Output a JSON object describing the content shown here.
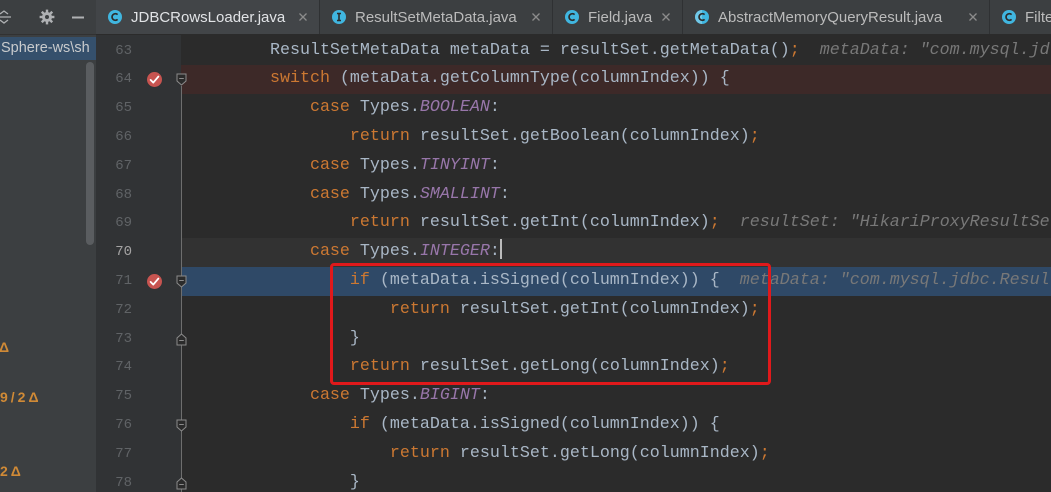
{
  "project_panel": {
    "toolbar_icons": [
      "collapse-all-icon",
      "gear-icon",
      "hide-icon"
    ],
    "selected_item": "Sphere-ws\\sh",
    "change_markers": [
      "Δ",
      "9/2Δ",
      "2Δ"
    ]
  },
  "tabs": [
    {
      "label": "JDBCRowsLoader.java",
      "icon": "class-icon",
      "active": true
    },
    {
      "label": "ResultSetMetaData.java",
      "icon": "interface-icon",
      "active": false
    },
    {
      "label": "Field.java",
      "icon": "class-icon",
      "active": false
    },
    {
      "label": "AbstractMemoryQueryResult.java",
      "icon": "abstract-class-icon",
      "active": false
    },
    {
      "label": "Filte",
      "icon": "class-icon",
      "active": false
    }
  ],
  "editor": {
    "lines": [
      {
        "number": 63,
        "segments": [
          {
            "plain": "        ResultSetMetaData metaData = resultSet.getMetaData()"
          },
          {
            "punct": ";"
          }
        ],
        "hint": "metaData: \"com.mysql.jd"
      },
      {
        "number": 64,
        "breakpoint": true,
        "fold_start": true,
        "segments": [
          {
            "keyword": "        switch"
          },
          {
            "plain": " (metaData.getColumnType(columnIndex)) {"
          }
        ]
      },
      {
        "number": 65,
        "segments": [
          {
            "keyword": "            case"
          },
          {
            "plain": " Types."
          },
          {
            "constant": "BOOLEAN"
          },
          {
            "plain": ":"
          }
        ]
      },
      {
        "number": 66,
        "segments": [
          {
            "keyword": "                return"
          },
          {
            "plain": " resultSet.getBoolean(columnIndex)"
          },
          {
            "punct": ";"
          }
        ]
      },
      {
        "number": 67,
        "segments": [
          {
            "keyword": "            case"
          },
          {
            "plain": " Types."
          },
          {
            "constant": "TINYINT"
          },
          {
            "plain": ":"
          }
        ]
      },
      {
        "number": 68,
        "segments": [
          {
            "keyword": "            case"
          },
          {
            "plain": " Types."
          },
          {
            "constant": "SMALLINT"
          },
          {
            "plain": ":"
          }
        ]
      },
      {
        "number": 69,
        "segments": [
          {
            "keyword": "                return"
          },
          {
            "plain": " resultSet.getInt(columnIndex)"
          },
          {
            "punct": ";"
          }
        ],
        "hint": "resultSet: \"HikariProxyResultSe"
      },
      {
        "number": 70,
        "caret": true,
        "segments": [
          {
            "keyword": "            case"
          },
          {
            "plain": " Types."
          },
          {
            "constant": "INTEGER"
          },
          {
            "plain": ":"
          }
        ]
      },
      {
        "number": 71,
        "breakpoint": true,
        "execution_point": true,
        "fold_start": true,
        "segments": [
          {
            "keyword": "                if"
          },
          {
            "plain": " (metaData.isSigned(columnIndex)) {"
          }
        ],
        "hint": "metaData: \"com.mysql.jdbc.Resul"
      },
      {
        "number": 72,
        "segments": [
          {
            "keyword": "                    return"
          },
          {
            "plain": " resultSet.getInt(columnIndex)"
          },
          {
            "punct": ";"
          }
        ]
      },
      {
        "number": 73,
        "fold_end": true,
        "segments": [
          {
            "plain": "                }"
          }
        ]
      },
      {
        "number": 74,
        "segments": [
          {
            "keyword": "                return"
          },
          {
            "plain": " resultSet.getLong(columnIndex)"
          },
          {
            "punct": ";"
          }
        ]
      },
      {
        "number": 75,
        "segments": [
          {
            "keyword": "            case"
          },
          {
            "plain": " Types."
          },
          {
            "constant": "BIGINT"
          },
          {
            "plain": ":"
          }
        ]
      },
      {
        "number": 76,
        "fold_start": true,
        "segments": [
          {
            "keyword": "                if"
          },
          {
            "plain": " (metaData.isSigned(columnIndex)) {"
          }
        ]
      },
      {
        "number": 77,
        "segments": [
          {
            "keyword": "                    return"
          },
          {
            "plain": " resultSet.getLong(columnIndex)"
          },
          {
            "punct": ";"
          }
        ]
      },
      {
        "number": 78,
        "fold_end": true,
        "segments": [
          {
            "plain": "                }"
          }
        ]
      }
    ]
  },
  "colors": {
    "keyword": "#CC7832",
    "text": "#A9B7C6",
    "constant": "#9876AA",
    "inline_hint": "#787878",
    "breakpoint": "#C75450",
    "breakpoint_line": "#3D2928",
    "execution_line": "#2F4967",
    "annotation_box": "#E0191B",
    "change_marker": "#D08A36"
  }
}
